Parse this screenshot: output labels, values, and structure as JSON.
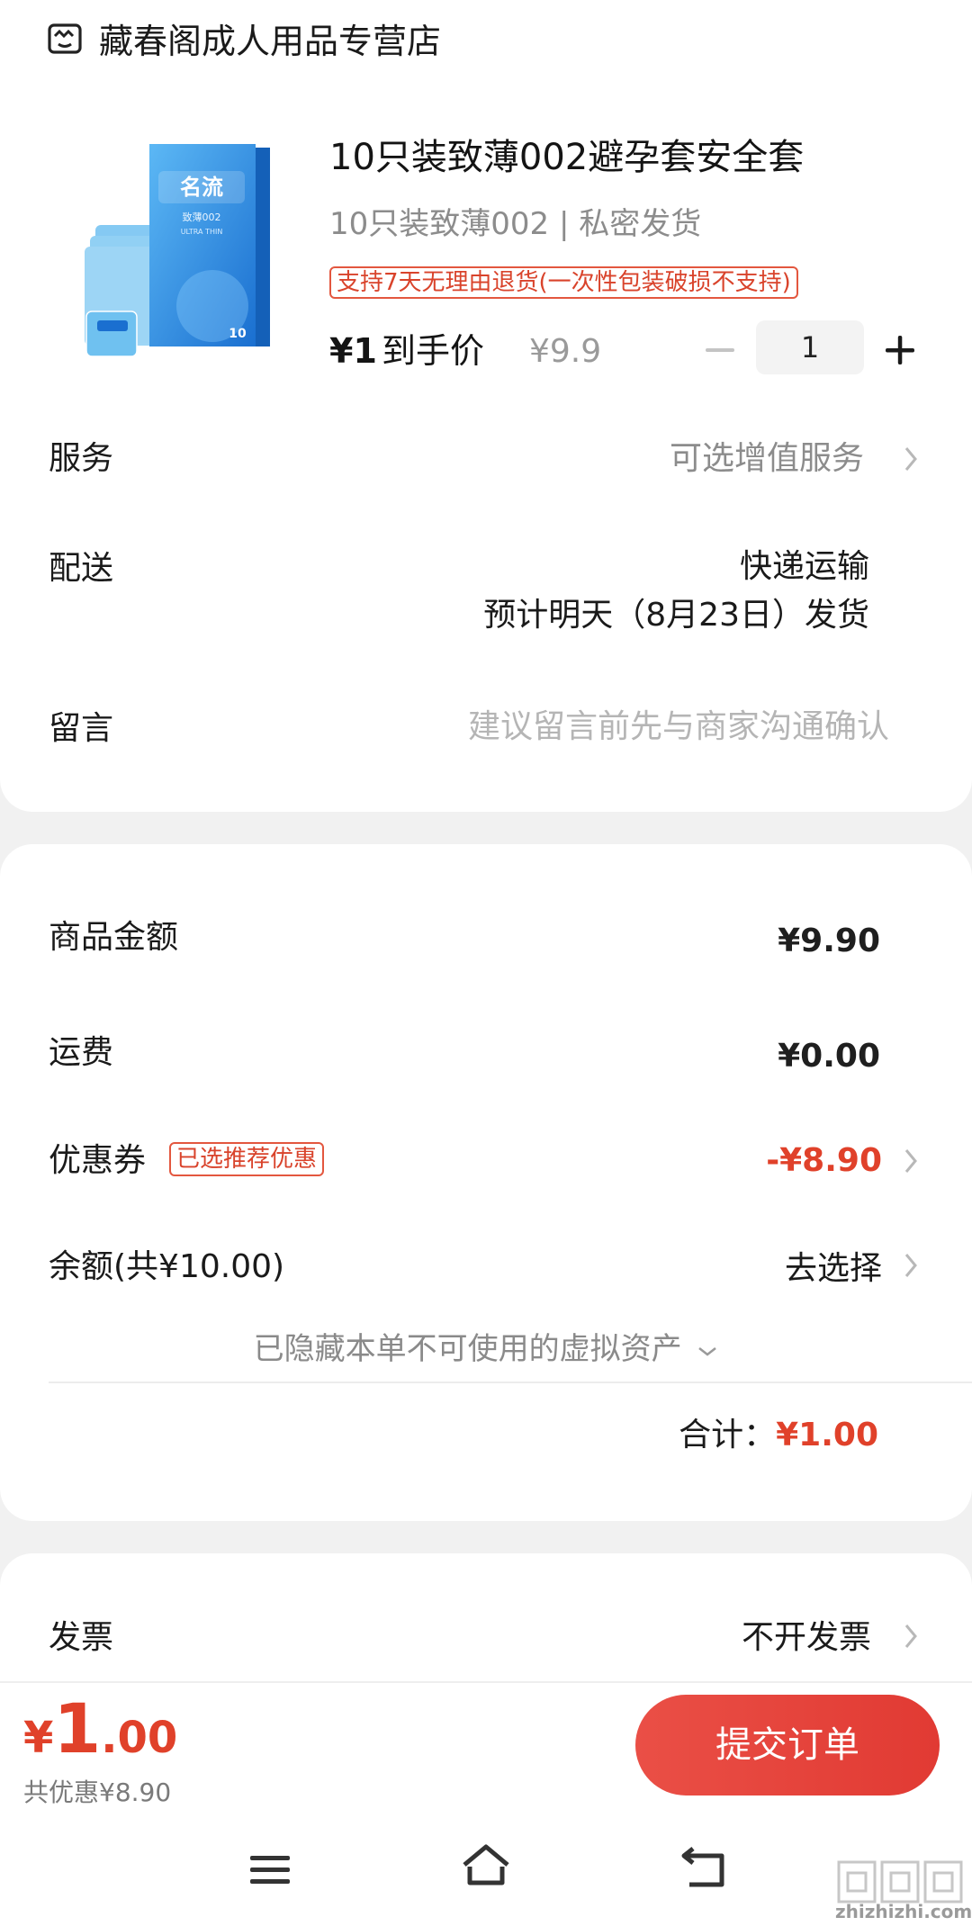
{
  "shop": {
    "name": "藏春阁成人用品专营店",
    "icon": "shop-icon"
  },
  "product": {
    "title": "10只装致薄002避孕套安全套",
    "spec": "10只装致薄002 | 私密发货",
    "return_policy": "支持7天无理由退货(一次性包装破损不支持)",
    "price_now": "¥1",
    "price_label": "到手价",
    "price_original": "¥9.9",
    "quantity": "1",
    "image_brand_text": "名流",
    "image_sub_text": "致薄002",
    "image_series": "ULTRA THIN",
    "image_pack_count": "10"
  },
  "order_rows": {
    "service_label": "服务",
    "service_value": "可选增值服务",
    "delivery_label": "配送",
    "delivery_method": "快递运输",
    "delivery_estimate": "预计明天（8月23日）发货",
    "message_label": "留言",
    "message_placeholder": "建议留言前先与商家沟通确认"
  },
  "summary": {
    "goods_amount_label": "商品金额",
    "goods_amount": "¥9.90",
    "shipping_label": "运费",
    "shipping": "¥0.00",
    "coupon_label": "优惠券",
    "coupon_tag": "已选推荐优惠",
    "coupon_value": "-¥8.90",
    "balance_label": "余额(共¥10.00)",
    "balance_action": "去选择",
    "hidden_assets": "已隐藏本单不可使用的虚拟资产",
    "total_label": "合计：",
    "total_value": "¥1.00"
  },
  "invoice": {
    "label": "发票",
    "value": "不开发票"
  },
  "bottom_bar": {
    "total_yen": "¥",
    "total_int": "1",
    "total_dec": ".00",
    "saving": "共优惠¥8.90",
    "submit": "提交订单"
  },
  "system_nav": {
    "menu": "menu-icon",
    "home": "home-icon",
    "back": "back-icon"
  },
  "watermark": {
    "text": "zhizhizhi.com"
  },
  "colors": {
    "accent": "#e0412a",
    "button": "#e54440",
    "muted": "#8c8c8c"
  }
}
